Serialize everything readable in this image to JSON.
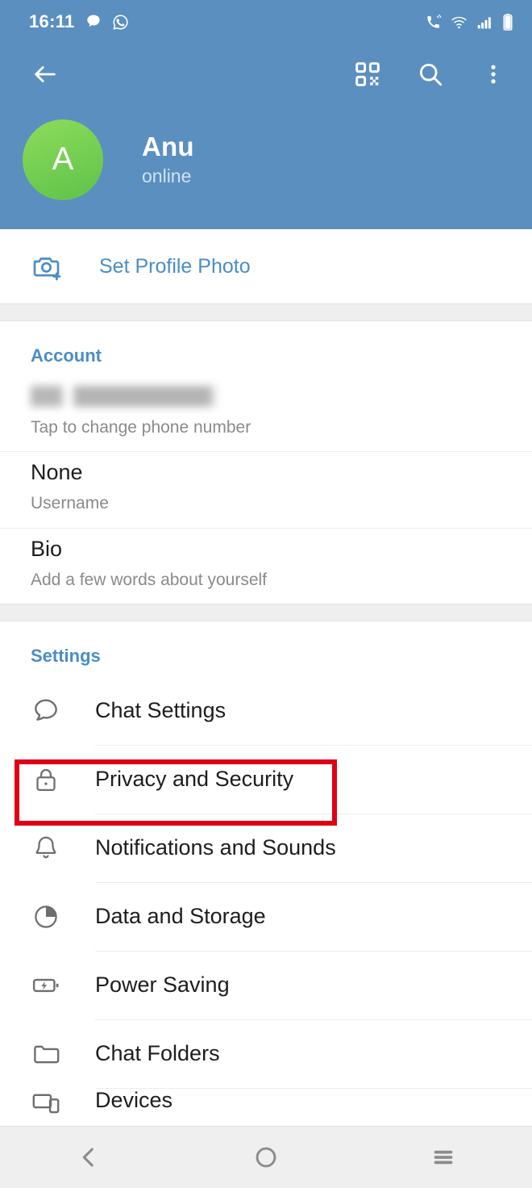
{
  "status_bar": {
    "time": "16:11",
    "left_icons": [
      "chat-bubble-icon",
      "whatsapp-icon"
    ],
    "right_icons": [
      "call-vibrate-icon",
      "wifi-icon",
      "cellular-signal-icon",
      "battery-icon"
    ]
  },
  "toolbar": {
    "back_label": "Back",
    "qr_label": "QR code",
    "search_label": "Search",
    "more_label": "More options",
    "icons": [
      "back-arrow-icon",
      "qr-code-icon",
      "search-icon",
      "overflow-menu-icon"
    ]
  },
  "profile": {
    "avatar_initial": "A",
    "name": "Anu",
    "status": "online"
  },
  "profile_photo": {
    "label": "Set Profile Photo",
    "icon": "camera-plus-icon"
  },
  "account": {
    "title": "Account",
    "rows": [
      {
        "primary": "",
        "primary_redacted": true,
        "secondary": "Tap to change phone number"
      },
      {
        "primary": "None",
        "secondary": "Username"
      },
      {
        "primary": "Bio",
        "secondary": "Add a few words about yourself"
      }
    ]
  },
  "settings": {
    "title": "Settings",
    "items": [
      {
        "label": "Chat Settings",
        "icon": "chat-bubble-icon"
      },
      {
        "label": "Privacy and Security",
        "icon": "lock-icon",
        "highlighted": true
      },
      {
        "label": "Notifications and Sounds",
        "icon": "bell-icon"
      },
      {
        "label": "Data and Storage",
        "icon": "pie-chart-icon"
      },
      {
        "label": "Power Saving",
        "icon": "battery-bolt-icon"
      },
      {
        "label": "Chat Folders",
        "icon": "folder-icon"
      },
      {
        "label": "Devices",
        "icon": "devices-icon"
      }
    ]
  },
  "navbar": {
    "back_label": "Back",
    "home_label": "Home",
    "recents_label": "Recents",
    "icons": [
      "nav-back-icon",
      "nav-home-icon",
      "nav-recents-icon"
    ]
  },
  "colors": {
    "header_blue": "#5b8fc0",
    "accent_blue": "#4b8dc4",
    "avatar_green": "#5ec24a",
    "highlight_red": "#e00016",
    "band_gray": "#efefef"
  }
}
